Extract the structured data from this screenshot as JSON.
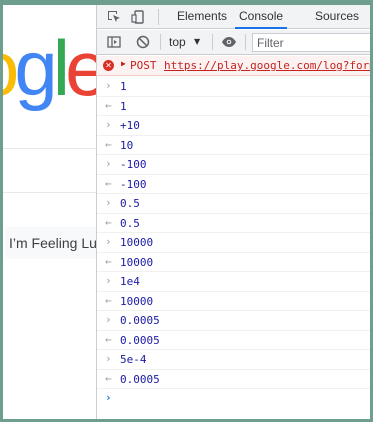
{
  "browser": {
    "cropped_title_glyphs": "⌐⌐|  •••"
  },
  "page": {
    "logo_letters": [
      "o",
      "g",
      "l",
      "e"
    ],
    "lucky_button": "I’m Feeling Lucky"
  },
  "devtools": {
    "tabs": [
      {
        "label": "Elements",
        "active": false
      },
      {
        "label": "Console",
        "active": true
      },
      {
        "label": "Sources",
        "active": false
      }
    ],
    "toolbar": {
      "context": "top",
      "filter_placeholder": "Filter"
    },
    "console": {
      "error": {
        "method": "POST",
        "url": "https://play.google.com/log?format=json"
      },
      "entries": [
        {
          "kind": "input",
          "text": "1"
        },
        {
          "kind": "output",
          "text": "1"
        },
        {
          "kind": "input",
          "text": "+10"
        },
        {
          "kind": "output",
          "text": "10"
        },
        {
          "kind": "input",
          "text": "-100"
        },
        {
          "kind": "output",
          "text": "-100"
        },
        {
          "kind": "input",
          "text": "0.5"
        },
        {
          "kind": "output",
          "text": "0.5"
        },
        {
          "kind": "input",
          "text": "10000"
        },
        {
          "kind": "output",
          "text": "10000"
        },
        {
          "kind": "input",
          "text": "1e4"
        },
        {
          "kind": "output",
          "text": "10000"
        },
        {
          "kind": "input",
          "text": "0.0005"
        },
        {
          "kind": "output",
          "text": "0.0005"
        },
        {
          "kind": "input",
          "text": "5e-4"
        },
        {
          "kind": "output",
          "text": "0.0005"
        }
      ]
    }
  },
  "colors": {
    "frame": "#6e9e8e",
    "accent": "#1a73e8",
    "error": "#d93025",
    "value": "#1a1aa6"
  }
}
